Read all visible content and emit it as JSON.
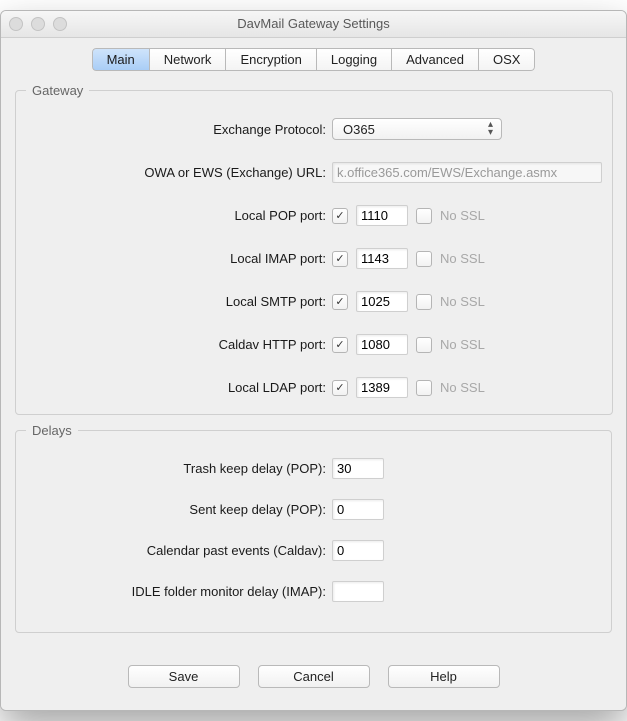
{
  "window": {
    "title": "DavMail Gateway Settings"
  },
  "tabs": [
    {
      "label": "Main",
      "active": true
    },
    {
      "label": "Network",
      "active": false
    },
    {
      "label": "Encryption",
      "active": false
    },
    {
      "label": "Logging",
      "active": false
    },
    {
      "label": "Advanced",
      "active": false
    },
    {
      "label": "OSX",
      "active": false
    }
  ],
  "gateway": {
    "legend": "Gateway",
    "protocol_label": "Exchange Protocol:",
    "protocol_value": "O365",
    "url_label": "OWA or EWS (Exchange) URL:",
    "url_value": "k.office365.com/EWS/Exchange.asmx",
    "nossl_label": "No SSL",
    "ports": [
      {
        "label": "Local POP port:",
        "enabled": true,
        "value": "1110",
        "nossl": false
      },
      {
        "label": "Local IMAP port:",
        "enabled": true,
        "value": "1143",
        "nossl": false
      },
      {
        "label": "Local SMTP port:",
        "enabled": true,
        "value": "1025",
        "nossl": false
      },
      {
        "label": "Caldav HTTP port:",
        "enabled": true,
        "value": "1080",
        "nossl": false
      },
      {
        "label": "Local LDAP port:",
        "enabled": true,
        "value": "1389",
        "nossl": false
      }
    ]
  },
  "delays": {
    "legend": "Delays",
    "items": [
      {
        "label": "Trash keep delay (POP):",
        "value": "30"
      },
      {
        "label": "Sent keep delay (POP):",
        "value": "0"
      },
      {
        "label": "Calendar past events (Caldav):",
        "value": "0"
      },
      {
        "label": "IDLE folder monitor delay (IMAP):",
        "value": ""
      }
    ]
  },
  "buttons": {
    "save": "Save",
    "cancel": "Cancel",
    "help": "Help"
  }
}
